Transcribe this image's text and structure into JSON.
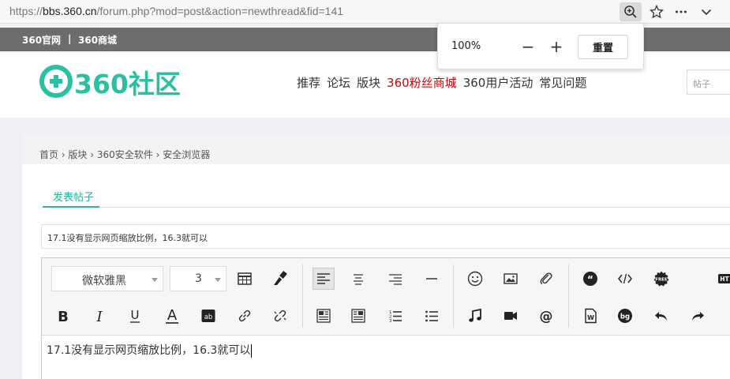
{
  "browser": {
    "url_prefix": "https://",
    "url_host": "bbs.360.cn",
    "url_path": "/forum.php?mod=post&action=newthread&fid=141",
    "icons": [
      "zoom-icon",
      "star-icon",
      "more-icon",
      "chevron-down-icon"
    ]
  },
  "zoom_popup": {
    "level": "100%",
    "minus": "−",
    "plus": "+",
    "reset": "重置"
  },
  "topstrip": {
    "links": [
      "360官网",
      "|",
      "360商城"
    ]
  },
  "header": {
    "logo_text": "360社区",
    "logo_color": "#2bbfa4",
    "nav": [
      {
        "label": "推荐",
        "hot": false
      },
      {
        "label": "论坛",
        "hot": false
      },
      {
        "label": "版块",
        "hot": false
      },
      {
        "label": "360粉丝商城",
        "hot": true
      },
      {
        "label": "360用户活动",
        "hot": false
      },
      {
        "label": "常见问题",
        "hot": false
      }
    ],
    "search_placeholder": "帖子"
  },
  "breadcrumb": "首页 › 版块 › 360安全软件 › 安全浏览器",
  "tab_label": "发表帖子",
  "title_value": "17.1没有显示网页缩放比例，16.3就可以",
  "editor": {
    "font_family": "微软雅黑",
    "font_size": "3",
    "content": "17.1没有显示网页缩放比例，16.3就可以",
    "overflow_label": "HT"
  },
  "colors": {
    "accent": "#2bbfa4",
    "nav_hot": "#d40000",
    "topstrip_bg": "#6d6d6d"
  }
}
